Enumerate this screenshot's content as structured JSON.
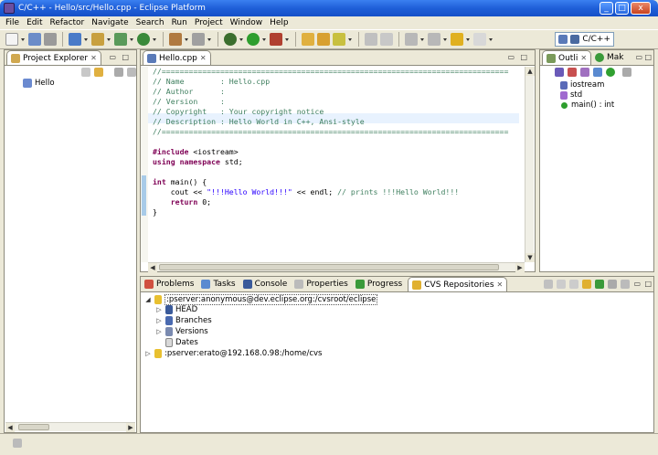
{
  "window": {
    "title": "C/C++ - Hello/src/Hello.cpp - Eclipse Platform",
    "minimize": "_",
    "maximize": "□",
    "close": "x"
  },
  "menu": [
    "File",
    "Edit",
    "Refactor",
    "Navigate",
    "Search",
    "Run",
    "Project",
    "Window",
    "Help"
  ],
  "perspective": {
    "label": "C/C++"
  },
  "project_explorer": {
    "tab": "Project Explorer",
    "tree": [
      {
        "label": "Hello"
      }
    ]
  },
  "editor": {
    "tab": "Hello.cpp",
    "lines": [
      "//=============================================================================",
      "// Name        : Hello.cpp",
      "// Author      :",
      "// Version     :",
      "// Copyright   : Your copyright notice",
      "// Description : Hello World in C++, Ansi-style",
      "//=============================================================================",
      "",
      "#include <iostream>",
      "using namespace std;",
      "",
      "int main() {",
      "    cout << \"!!!Hello World!!!\" << endl; // prints !!!Hello World!!!",
      "    return 0;",
      "}"
    ]
  },
  "outline": {
    "tabs": [
      "Outli",
      "Mak"
    ],
    "items": [
      {
        "label": "iostream"
      },
      {
        "label": "std"
      },
      {
        "label": "main() : int"
      }
    ]
  },
  "bottom": {
    "tabs": [
      "Problems",
      "Tasks",
      "Console",
      "Properties",
      "Progress",
      "CVS Repositories"
    ],
    "repositories": [
      {
        "label": ":pserver:anonymous@dev.eclipse.org:/cvsroot/eclipse",
        "children": [
          "HEAD",
          "Branches",
          "Versions",
          "Dates"
        ]
      },
      {
        "label": ":pserver:erato@192.168.0.98:/home/cvs"
      }
    ]
  },
  "colors": {
    "keyword": "#7f0055",
    "comment": "#3f7f5f",
    "string": "#2a00ff",
    "include": "#7f0055"
  }
}
